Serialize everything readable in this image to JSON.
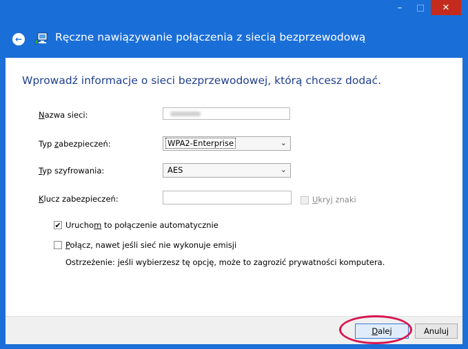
{
  "window": {
    "title": "Ręczne nawiązywanie połączenia z siecią bezprzewodową",
    "minimize_glyph": "–",
    "maximize_glyph": "□",
    "close_glyph": "✕",
    "back_glyph": "←"
  },
  "form": {
    "heading": "Wprowadź informacje o sieci bezprzewodowej, którą chcesz dodać.",
    "network_name": {
      "label_prefix": "",
      "label_mnemonic": "N",
      "label_suffix": "azwa sieci:",
      "value": ""
    },
    "security_type": {
      "label_prefix": "Typ ",
      "label_mnemonic": "z",
      "label_suffix": "abezpieczeń:",
      "value": "WPA2-Enterprise"
    },
    "encryption_type": {
      "label_prefix": "",
      "label_mnemonic": "T",
      "label_suffix": "yp szyfrowania:",
      "value": "AES"
    },
    "security_key": {
      "label_prefix": "",
      "label_mnemonic": "K",
      "label_suffix": "lucz zabezpieczeń:",
      "value": "",
      "hide_chars_mnemonic": "U",
      "hide_chars_suffix": "kryj znaki",
      "hide_chars_checked": false
    },
    "auto_connect": {
      "checked": true,
      "label_prefix": "Urucho",
      "label_mnemonic": "m",
      "label_suffix": " to połączenie automatycznie"
    },
    "connect_hidden": {
      "checked": false,
      "label_prefix": "",
      "label_mnemonic": "P",
      "label_suffix": "ołącz, nawet jeśli sieć nie wykonuje emisji"
    },
    "warning": "Ostrzeżenie: jeśli wybierzesz tę opcję, może to zagrozić prywatności komputera.",
    "check_glyph": "✔",
    "dropdown_glyph": "⌄"
  },
  "footer": {
    "next_mnemonic": "D",
    "next_suffix": "alej",
    "cancel_label": "Anuluj"
  },
  "colors": {
    "title_bar": "#1a6ed8",
    "heading": "#1f3f8f",
    "highlight_ring": "#d8154f"
  }
}
